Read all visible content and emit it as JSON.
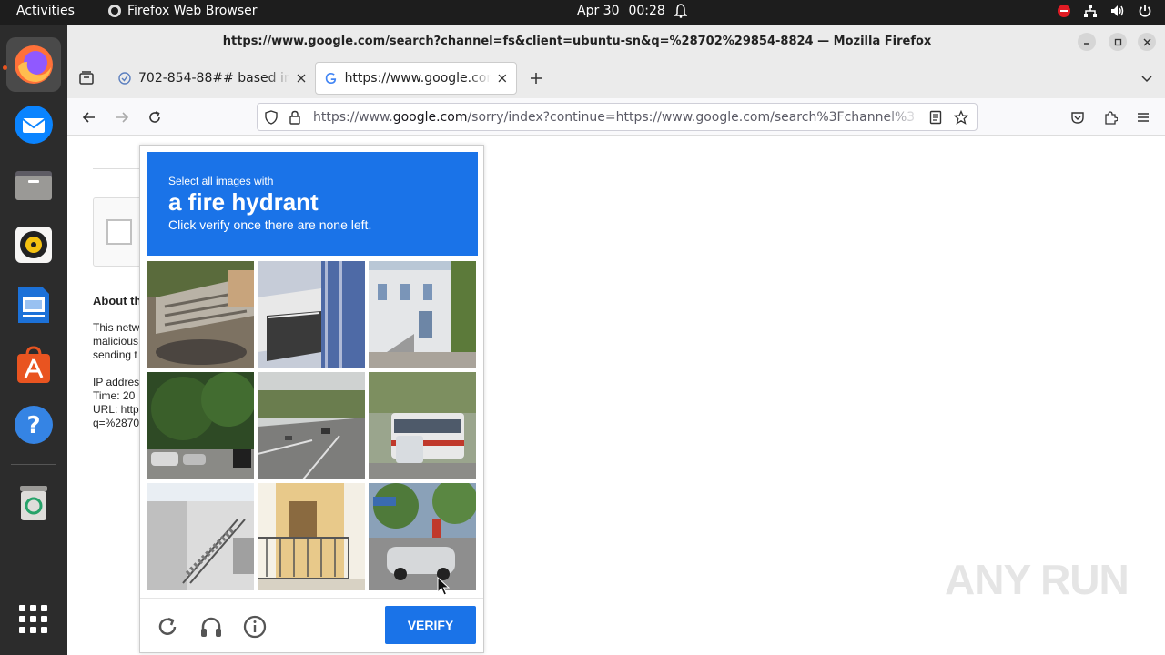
{
  "topbar": {
    "activities": "Activities",
    "app_name": "Firefox Web Browser",
    "date": "Apr 30",
    "time": "00:28"
  },
  "window": {
    "title": "https://www.google.com/search?channel=fs&client=ubuntu-sn&q=%28702%29854-8824 — Mozilla Firefox"
  },
  "tabs": [
    {
      "label": "702-854-88## based in L",
      "icon": "spam-site-favicon",
      "active": false
    },
    {
      "label": "https://www.google.com",
      "icon": "google-favicon",
      "active": true
    }
  ],
  "url": {
    "prefix": "https://www.",
    "domain": "google.com",
    "rest": "/sorry/index?continue=https://www.google.com/search%3Fchannel%3"
  },
  "page_bg": {
    "about": "About th",
    "line1": "This netw",
    "line2": "malicious",
    "line3": "sending t",
    "ip": "IP addres",
    "time": "Time: 20",
    "url": "URL: http",
    "q": "q=%2870"
  },
  "captcha": {
    "instruction_small": "Select all images with",
    "target": "a fire hydrant",
    "instruction_sub": "Click verify once there are none left.",
    "verify_label": "VERIFY",
    "header_color": "#1a73e8",
    "tiles": [
      "outdoor-stairs",
      "building-balcony",
      "house-street",
      "tree-street-cars",
      "highway-road",
      "bus-street",
      "apartment-stairs",
      "yellow-building-balcony",
      "street-cars-intersection"
    ]
  },
  "watermark": "ANY RUN"
}
